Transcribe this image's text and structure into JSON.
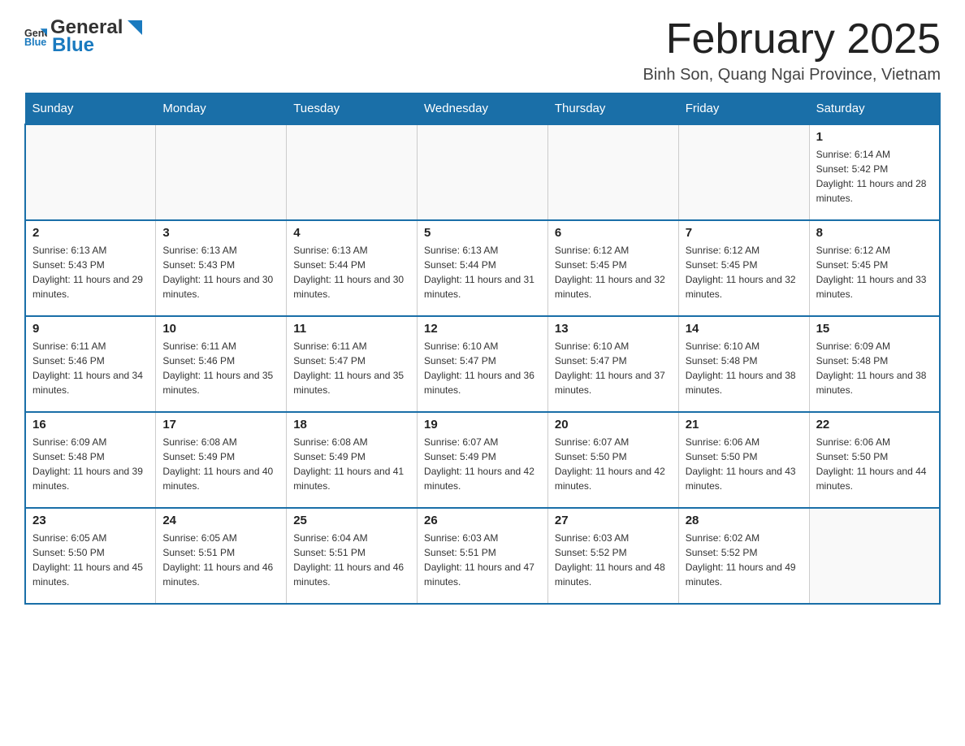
{
  "logo": {
    "text_general": "General",
    "text_blue": "Blue"
  },
  "header": {
    "month_title": "February 2025",
    "location": "Binh Son, Quang Ngai Province, Vietnam"
  },
  "weekdays": [
    "Sunday",
    "Monday",
    "Tuesday",
    "Wednesday",
    "Thursday",
    "Friday",
    "Saturday"
  ],
  "rows": [
    [
      {
        "day": "",
        "sunrise": "",
        "sunset": "",
        "daylight": ""
      },
      {
        "day": "",
        "sunrise": "",
        "sunset": "",
        "daylight": ""
      },
      {
        "day": "",
        "sunrise": "",
        "sunset": "",
        "daylight": ""
      },
      {
        "day": "",
        "sunrise": "",
        "sunset": "",
        "daylight": ""
      },
      {
        "day": "",
        "sunrise": "",
        "sunset": "",
        "daylight": ""
      },
      {
        "day": "",
        "sunrise": "",
        "sunset": "",
        "daylight": ""
      },
      {
        "day": "1",
        "sunrise": "Sunrise: 6:14 AM",
        "sunset": "Sunset: 5:42 PM",
        "daylight": "Daylight: 11 hours and 28 minutes."
      }
    ],
    [
      {
        "day": "2",
        "sunrise": "Sunrise: 6:13 AM",
        "sunset": "Sunset: 5:43 PM",
        "daylight": "Daylight: 11 hours and 29 minutes."
      },
      {
        "day": "3",
        "sunrise": "Sunrise: 6:13 AM",
        "sunset": "Sunset: 5:43 PM",
        "daylight": "Daylight: 11 hours and 30 minutes."
      },
      {
        "day": "4",
        "sunrise": "Sunrise: 6:13 AM",
        "sunset": "Sunset: 5:44 PM",
        "daylight": "Daylight: 11 hours and 30 minutes."
      },
      {
        "day": "5",
        "sunrise": "Sunrise: 6:13 AM",
        "sunset": "Sunset: 5:44 PM",
        "daylight": "Daylight: 11 hours and 31 minutes."
      },
      {
        "day": "6",
        "sunrise": "Sunrise: 6:12 AM",
        "sunset": "Sunset: 5:45 PM",
        "daylight": "Daylight: 11 hours and 32 minutes."
      },
      {
        "day": "7",
        "sunrise": "Sunrise: 6:12 AM",
        "sunset": "Sunset: 5:45 PM",
        "daylight": "Daylight: 11 hours and 32 minutes."
      },
      {
        "day": "8",
        "sunrise": "Sunrise: 6:12 AM",
        "sunset": "Sunset: 5:45 PM",
        "daylight": "Daylight: 11 hours and 33 minutes."
      }
    ],
    [
      {
        "day": "9",
        "sunrise": "Sunrise: 6:11 AM",
        "sunset": "Sunset: 5:46 PM",
        "daylight": "Daylight: 11 hours and 34 minutes."
      },
      {
        "day": "10",
        "sunrise": "Sunrise: 6:11 AM",
        "sunset": "Sunset: 5:46 PM",
        "daylight": "Daylight: 11 hours and 35 minutes."
      },
      {
        "day": "11",
        "sunrise": "Sunrise: 6:11 AM",
        "sunset": "Sunset: 5:47 PM",
        "daylight": "Daylight: 11 hours and 35 minutes."
      },
      {
        "day": "12",
        "sunrise": "Sunrise: 6:10 AM",
        "sunset": "Sunset: 5:47 PM",
        "daylight": "Daylight: 11 hours and 36 minutes."
      },
      {
        "day": "13",
        "sunrise": "Sunrise: 6:10 AM",
        "sunset": "Sunset: 5:47 PM",
        "daylight": "Daylight: 11 hours and 37 minutes."
      },
      {
        "day": "14",
        "sunrise": "Sunrise: 6:10 AM",
        "sunset": "Sunset: 5:48 PM",
        "daylight": "Daylight: 11 hours and 38 minutes."
      },
      {
        "day": "15",
        "sunrise": "Sunrise: 6:09 AM",
        "sunset": "Sunset: 5:48 PM",
        "daylight": "Daylight: 11 hours and 38 minutes."
      }
    ],
    [
      {
        "day": "16",
        "sunrise": "Sunrise: 6:09 AM",
        "sunset": "Sunset: 5:48 PM",
        "daylight": "Daylight: 11 hours and 39 minutes."
      },
      {
        "day": "17",
        "sunrise": "Sunrise: 6:08 AM",
        "sunset": "Sunset: 5:49 PM",
        "daylight": "Daylight: 11 hours and 40 minutes."
      },
      {
        "day": "18",
        "sunrise": "Sunrise: 6:08 AM",
        "sunset": "Sunset: 5:49 PM",
        "daylight": "Daylight: 11 hours and 41 minutes."
      },
      {
        "day": "19",
        "sunrise": "Sunrise: 6:07 AM",
        "sunset": "Sunset: 5:49 PM",
        "daylight": "Daylight: 11 hours and 42 minutes."
      },
      {
        "day": "20",
        "sunrise": "Sunrise: 6:07 AM",
        "sunset": "Sunset: 5:50 PM",
        "daylight": "Daylight: 11 hours and 42 minutes."
      },
      {
        "day": "21",
        "sunrise": "Sunrise: 6:06 AM",
        "sunset": "Sunset: 5:50 PM",
        "daylight": "Daylight: 11 hours and 43 minutes."
      },
      {
        "day": "22",
        "sunrise": "Sunrise: 6:06 AM",
        "sunset": "Sunset: 5:50 PM",
        "daylight": "Daylight: 11 hours and 44 minutes."
      }
    ],
    [
      {
        "day": "23",
        "sunrise": "Sunrise: 6:05 AM",
        "sunset": "Sunset: 5:50 PM",
        "daylight": "Daylight: 11 hours and 45 minutes."
      },
      {
        "day": "24",
        "sunrise": "Sunrise: 6:05 AM",
        "sunset": "Sunset: 5:51 PM",
        "daylight": "Daylight: 11 hours and 46 minutes."
      },
      {
        "day": "25",
        "sunrise": "Sunrise: 6:04 AM",
        "sunset": "Sunset: 5:51 PM",
        "daylight": "Daylight: 11 hours and 46 minutes."
      },
      {
        "day": "26",
        "sunrise": "Sunrise: 6:03 AM",
        "sunset": "Sunset: 5:51 PM",
        "daylight": "Daylight: 11 hours and 47 minutes."
      },
      {
        "day": "27",
        "sunrise": "Sunrise: 6:03 AM",
        "sunset": "Sunset: 5:52 PM",
        "daylight": "Daylight: 11 hours and 48 minutes."
      },
      {
        "day": "28",
        "sunrise": "Sunrise: 6:02 AM",
        "sunset": "Sunset: 5:52 PM",
        "daylight": "Daylight: 11 hours and 49 minutes."
      },
      {
        "day": "",
        "sunrise": "",
        "sunset": "",
        "daylight": ""
      }
    ]
  ]
}
